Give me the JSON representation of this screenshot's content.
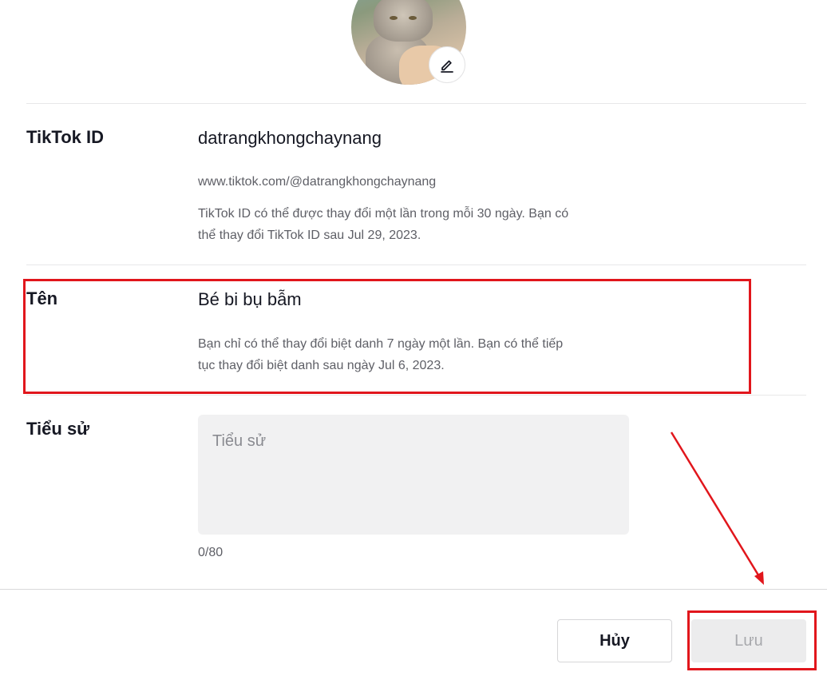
{
  "profile": {
    "tiktok_id": {
      "label": "TikTok ID",
      "value": "datrangkhongchaynang",
      "url": "www.tiktok.com/@datrangkhongchaynang",
      "note_line1": "TikTok ID có thể được thay đổi một lần trong mỗi 30 ngày. Bạn có",
      "note_line2": "thể thay đổi TikTok ID sau Jul 29, 2023."
    },
    "name": {
      "label": "Tên",
      "value": "Bé bi bụ bẫm",
      "note_line1": "Bạn chỉ có thể thay đổi biệt danh 7 ngày một lần. Bạn có thể tiếp",
      "note_line2": "tục thay đổi biệt danh sau ngày Jul 6, 2023."
    },
    "bio": {
      "label": "Tiểu sử",
      "placeholder": "Tiểu sử",
      "counter": "0/80"
    }
  },
  "actions": {
    "cancel_label": "Hủy",
    "save_label": "Lưu"
  },
  "colors": {
    "annotation": "#e1161c",
    "input_bg": "#f1f1f2",
    "disabled_button": "#ececed"
  },
  "icons": {
    "avatar_edit": "pencil-icon"
  }
}
